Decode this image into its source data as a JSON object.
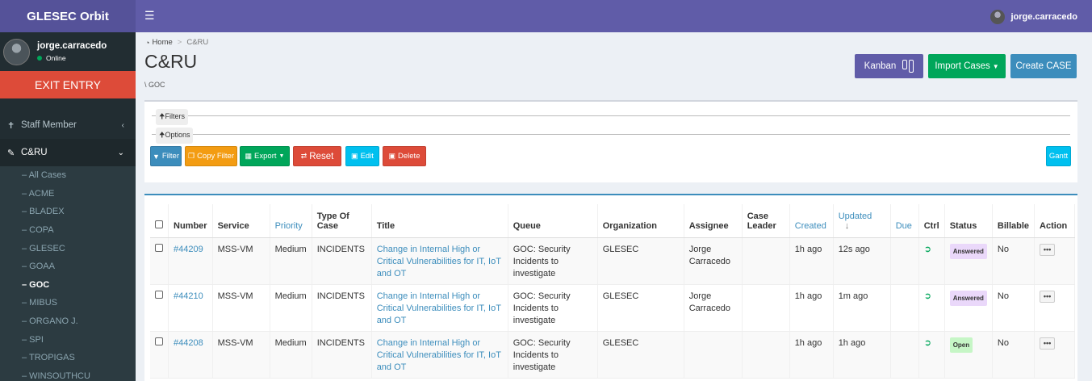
{
  "app": {
    "title": "GLESEC Orbit"
  },
  "user": {
    "name": "jorge.carracedo",
    "status": "Online"
  },
  "exit_label": "EXIT ENTRY",
  "sidebar": {
    "staff_label": "Staff Member",
    "cru_label": "C&RU",
    "subitems": [
      "– All Cases",
      "– ACME",
      "– BLADEX",
      "– COPA",
      "– GLESEC",
      "– GOAA",
      "– GOC",
      "– MIBUS",
      "– ORGANO J.",
      "– SPI",
      "– TROPIGAS",
      "– WINSOUTHCU"
    ]
  },
  "breadcrumb": {
    "home": "Home",
    "current": "C&RU"
  },
  "page": {
    "title": "C&RU",
    "subtitle": "\\ GOC"
  },
  "header_buttons": {
    "kanban": "Kanban",
    "import": "Import Cases",
    "create": "Create CASE"
  },
  "filters": {
    "filters_legend": "Filters",
    "options_legend": "Options",
    "buttons": {
      "filter": "Filter",
      "copy": "Copy Filter",
      "export": "Export",
      "reset": "Reset",
      "edit": "Edit",
      "delete": "Delete",
      "gantt": "Gantt"
    }
  },
  "table": {
    "headers": {
      "number": "Number",
      "service": "Service",
      "priority": "Priority",
      "type": "Type Of Case",
      "title": "Title",
      "queue": "Queue",
      "organization": "Organization",
      "assignee": "Assignee",
      "leader": "Case Leader",
      "created": "Created",
      "updated": "Updated",
      "sort_arrow": "↓",
      "due": "Due",
      "ctrl": "Ctrl",
      "status": "Status",
      "billable": "Billable",
      "action": "Action"
    },
    "rows": [
      {
        "number": "#44209",
        "service": "MSS-VM",
        "priority": "Medium",
        "type": "INCIDENTS",
        "title": "Change in Internal High or Critical Vulnerabilities for IT, IoT and OT",
        "queue": "GOC: Security Incidents to investigate",
        "organization": "GLESEC",
        "assignee": "Jorge Carracedo",
        "leader": "",
        "created": "1h ago",
        "updated": "12s ago",
        "due": "",
        "status": "Answered",
        "billable": "No"
      },
      {
        "number": "#44210",
        "service": "MSS-VM",
        "priority": "Medium",
        "type": "INCIDENTS",
        "title": "Change in Internal High or Critical Vulnerabilities for IT, IoT and OT",
        "queue": "GOC: Security Incidents to investigate",
        "organization": "GLESEC",
        "assignee": "Jorge Carracedo",
        "leader": "",
        "created": "1h ago",
        "updated": "1m ago",
        "due": "",
        "status": "Answered",
        "billable": "No"
      },
      {
        "number": "#44208",
        "service": "MSS-VM",
        "priority": "Medium",
        "type": "INCIDENTS",
        "title": "Change in Internal High or Critical Vulnerabilities for IT, IoT and OT",
        "queue": "GOC: Security Incidents to investigate",
        "organization": "GLESEC",
        "assignee": "",
        "leader": "",
        "created": "1h ago",
        "updated": "1h ago",
        "due": "",
        "status": "Open",
        "billable": "No"
      }
    ]
  },
  "colors": {
    "brand": "#605ca8",
    "sidebar": "#222d32",
    "danger": "#dd4b39",
    "success": "#00a65a",
    "primary": "#3c8dbc",
    "info": "#00c0ef",
    "warning": "#f39c12"
  },
  "icons": {
    "menu": "hamburger-icon",
    "home": "dashboard-icon",
    "staff": "pin-icon",
    "cru": "edit-icon",
    "kanban": "columns-icon",
    "ctrl": "sign-in-icon",
    "action": "ellipsis-icon"
  }
}
